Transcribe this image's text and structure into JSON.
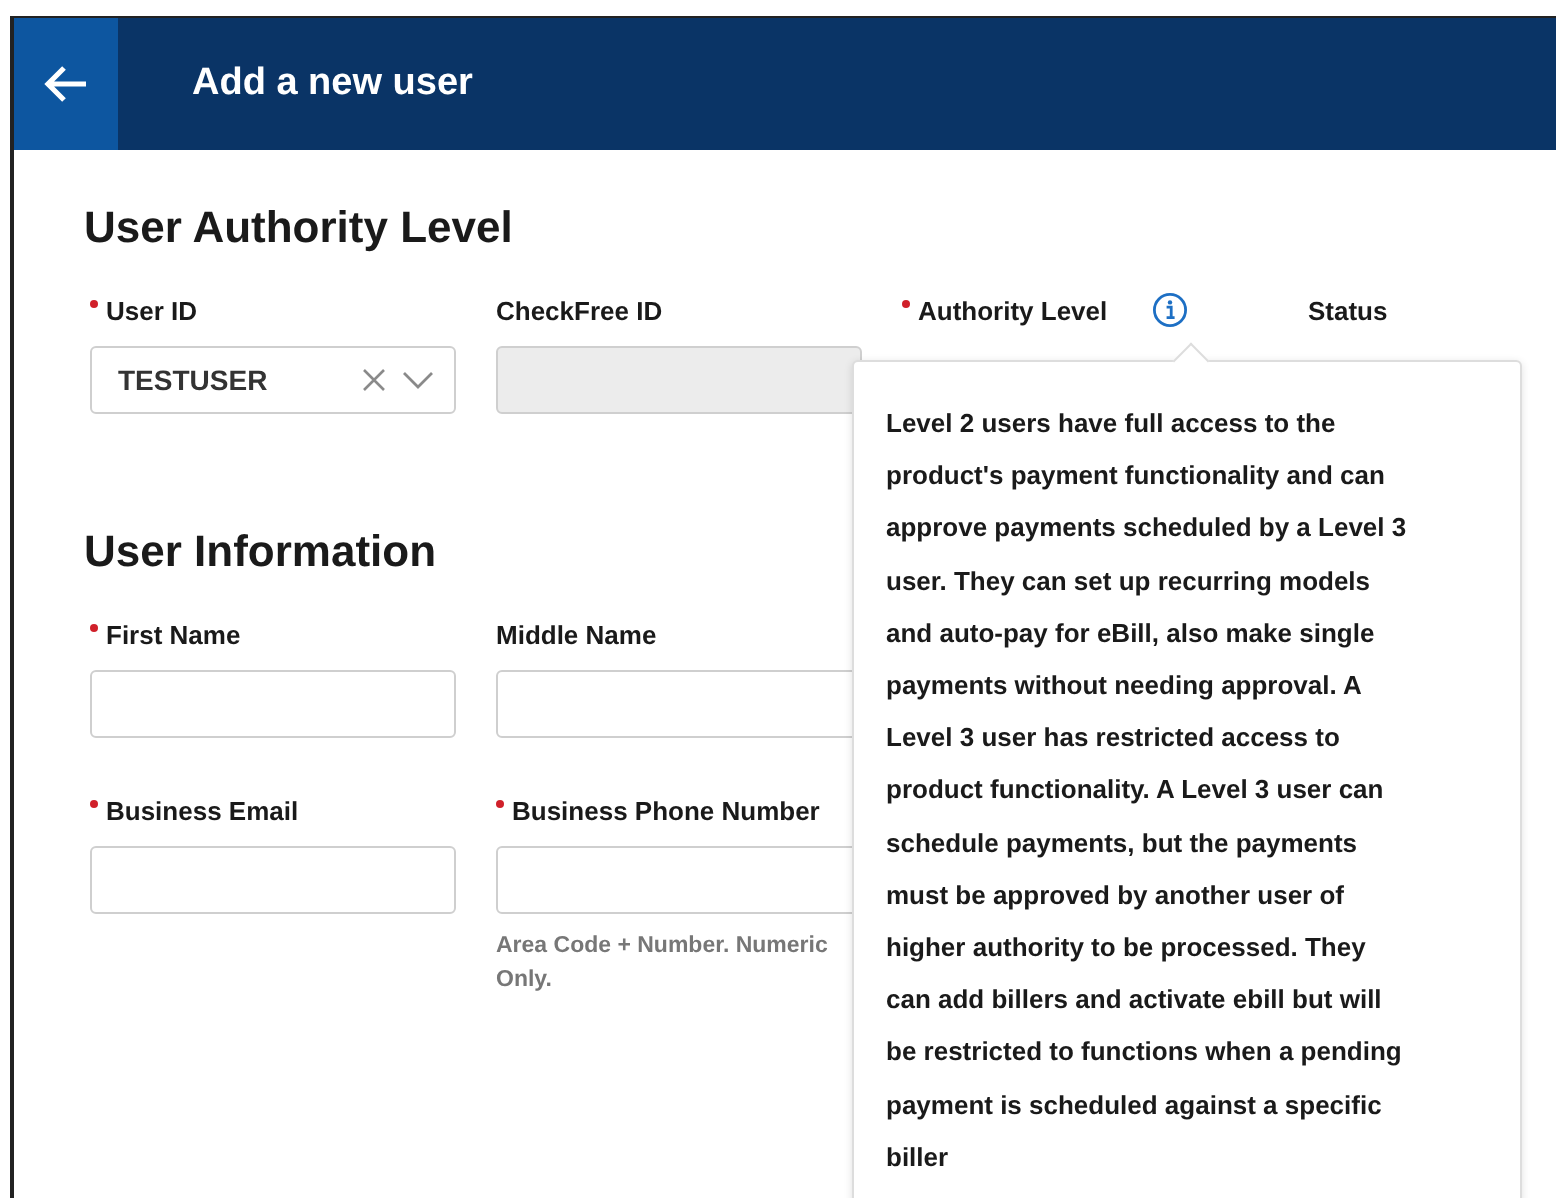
{
  "header": {
    "title": "Add a new user"
  },
  "sections": [
    {
      "title": "User Authority Level",
      "rows": [
        [
          {
            "label": "User ID",
            "required": true,
            "value": "TESTUSER",
            "kind": "select"
          },
          {
            "label": "CheckFree ID",
            "required": false,
            "kind": "text",
            "disabled": true
          },
          {
            "label": "Authority Level",
            "required": true,
            "kind": "none",
            "info": true
          },
          {
            "label": "Status",
            "required": false,
            "kind": "none"
          }
        ]
      ]
    },
    {
      "title": "User Information",
      "rows": [
        [
          {
            "label": "First Name",
            "required": true,
            "kind": "text",
            "disabled": false
          },
          {
            "label": "Middle Name",
            "required": false,
            "kind": "text",
            "disabled": false
          }
        ],
        [
          {
            "label": "Business Email",
            "required": true,
            "kind": "text",
            "disabled": false
          },
          {
            "label": "Business Phone Number",
            "required": true,
            "kind": "text",
            "disabled": false,
            "hint": "Area Code + Number. Numeric Only."
          }
        ]
      ]
    }
  ],
  "tooltip": {
    "text": "Level 2 users have full access to the\nproduct's payment functionality and can\napprove payments scheduled by a Level 3\nuser. They can set up recurring models\nand auto-pay for eBill, also make single\npayments without needing approval. A\nLevel 3 user has restricted access to\nproduct functionality. A Level 3 user can\nschedule payments, but the payments\nmust be approved by another user of\nhigher authority to be processed. They\ncan add billers and activate ebill but will\nbe restricted to functions when a pending\npayment is scheduled against a specific\nbiller"
  }
}
